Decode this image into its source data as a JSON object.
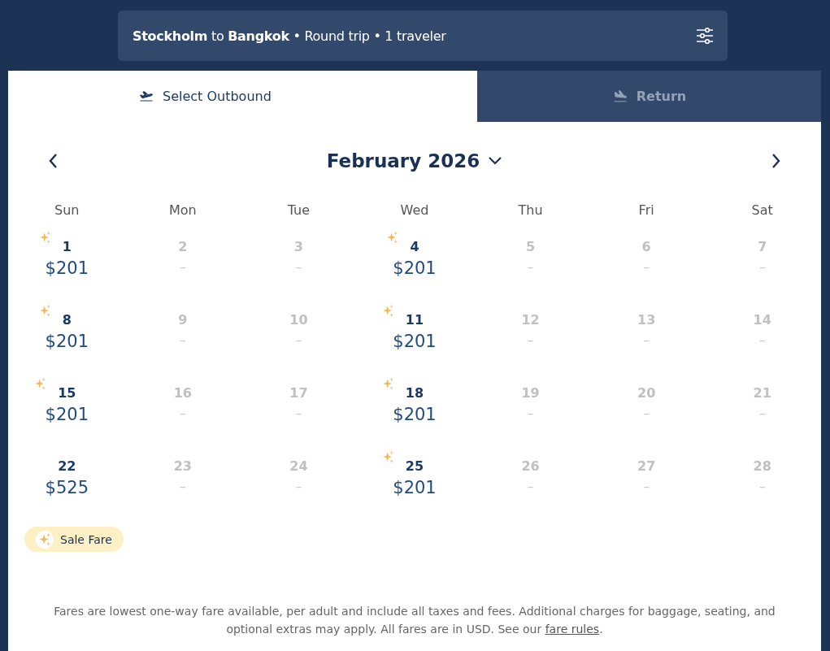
{
  "summary": "**Stockholm** to **Bangkok** • Round trip • 1 traveler",
  "tabs": [
    {
      "label": "Select Outbound",
      "kind": "depart",
      "selected": true
    },
    {
      "label": "Return",
      "kind": "arrive",
      "selected": false
    }
  ],
  "calendar": {
    "month": "February 2026",
    "weekdays": [
      "Sun",
      "Mon",
      "Tue",
      "Wed",
      "Thu",
      "Fri",
      "Sat"
    ],
    "days": [
      {
        "day": "1",
        "price": "$201",
        "available": true,
        "sale": true
      },
      {
        "day": "2",
        "price": "–",
        "available": false,
        "sale": false
      },
      {
        "day": "3",
        "price": "–",
        "available": false,
        "sale": false
      },
      {
        "day": "4",
        "price": "$201",
        "available": true,
        "sale": true
      },
      {
        "day": "5",
        "price": "–",
        "available": false,
        "sale": false
      },
      {
        "day": "6",
        "price": "–",
        "available": false,
        "sale": false
      },
      {
        "day": "7",
        "price": "–",
        "available": false,
        "sale": false
      },
      {
        "day": "8",
        "price": "$201",
        "available": true,
        "sale": true
      },
      {
        "day": "9",
        "price": "–",
        "available": false,
        "sale": false
      },
      {
        "day": "10",
        "price": "–",
        "available": false,
        "sale": false
      },
      {
        "day": "11",
        "price": "$201",
        "available": true,
        "sale": true
      },
      {
        "day": "12",
        "price": "–",
        "available": false,
        "sale": false
      },
      {
        "day": "13",
        "price": "–",
        "available": false,
        "sale": false
      },
      {
        "day": "14",
        "price": "–",
        "available": false,
        "sale": false
      },
      {
        "day": "15",
        "price": "$201",
        "available": true,
        "sale": true
      },
      {
        "day": "16",
        "price": "–",
        "available": false,
        "sale": false
      },
      {
        "day": "17",
        "price": "–",
        "available": false,
        "sale": false
      },
      {
        "day": "18",
        "price": "$201",
        "available": true,
        "sale": true
      },
      {
        "day": "19",
        "price": "–",
        "available": false,
        "sale": false
      },
      {
        "day": "20",
        "price": "–",
        "available": false,
        "sale": false
      },
      {
        "day": "21",
        "price": "–",
        "available": false,
        "sale": false
      },
      {
        "day": "22",
        "price": "$525",
        "available": true,
        "sale": false
      },
      {
        "day": "23",
        "price": "–",
        "available": false,
        "sale": false
      },
      {
        "day": "24",
        "price": "–",
        "available": false,
        "sale": false
      },
      {
        "day": "25",
        "price": "$201",
        "available": true,
        "sale": true
      },
      {
        "day": "26",
        "price": "–",
        "available": false,
        "sale": false
      },
      {
        "day": "27",
        "price": "–",
        "available": false,
        "sale": false
      },
      {
        "day": "28",
        "price": "–",
        "available": false,
        "sale": false
      }
    ]
  },
  "legend": {
    "label": "Sale Fare"
  },
  "footer": {
    "text": "Fares are lowest one-way fare available, per adult and include all taxes and fees. Additional charges for baggage, seating, and optional extras may apply. All fares are in USD. See our",
    "link": "fare rules",
    "end": "."
  }
}
